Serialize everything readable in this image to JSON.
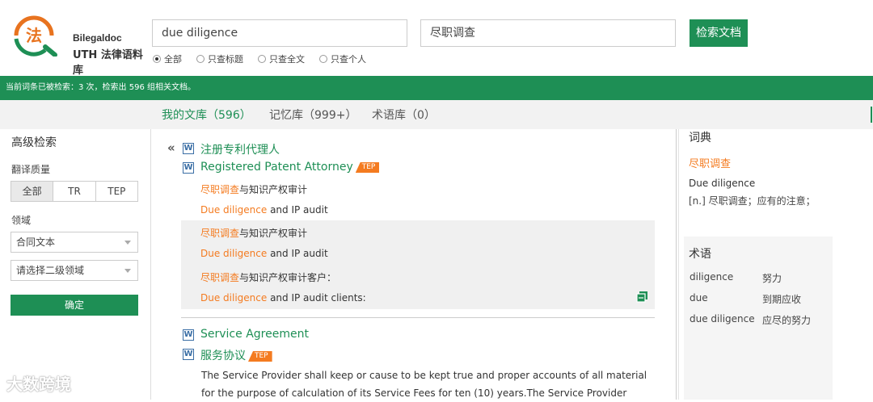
{
  "brand": {
    "name_line1": "Bilegaldoc",
    "name_line2": "UTH 法律语料库"
  },
  "search": {
    "query_en": "due diligence",
    "query_zh": "尽职调查",
    "button": "检索文档"
  },
  "scope_options": [
    {
      "label": "全部",
      "selected": true
    },
    {
      "label": "只查标题",
      "selected": false
    },
    {
      "label": "只查全文",
      "selected": false
    },
    {
      "label": "只查个人",
      "selected": false
    }
  ],
  "status": {
    "text": "当前词条已被检索：3 次，检索出 596 组相关文档。"
  },
  "tabs": [
    {
      "label": "我的文库（596）",
      "active": true
    },
    {
      "label": "记忆库（999+）",
      "active": false
    },
    {
      "label": "术语库（0）",
      "active": false
    }
  ],
  "sidebar": {
    "title": "高级检索",
    "quality_label": "翻译质量",
    "quality_options": [
      "全部",
      "TR",
      "TEP"
    ],
    "domain_label": "领域",
    "domain_value": "合同文本",
    "subdomain_placeholder": "请选择二级领域",
    "confirm": "确定"
  },
  "results": [
    {
      "title_zh": "注册专利代理人",
      "title_en": "Registered Patent Attorney",
      "badge": "TEP",
      "pairs": [
        {
          "zh_hl": "尽职调查",
          "zh_rest": "与知识产权审计",
          "en_hl": "Due diligence",
          "en_rest": " and IP audit"
        },
        {
          "zh_hl": "尽职调查",
          "zh_rest": "与知识产权审计",
          "en_hl": "Due diligence",
          "en_rest": " and IP audit"
        },
        {
          "zh_hl": "尽职调查",
          "zh_rest": "与知识产权审计客户：",
          "en_hl": "Due diligence",
          "en_rest": " and IP audit clients:"
        }
      ]
    },
    {
      "title_en": "Service Agreement",
      "title_zh": "服务协议",
      "badge": "TEP",
      "body_line1": "The Service Provider shall keep or cause to be kept true and proper accounts of all material",
      "body_line2": "for the purpose of calculation of its Service Fees for ten (10) years.The Service Provider"
    }
  ],
  "dictionary": {
    "heading": "词典",
    "term_zh": "尽职调查",
    "term_en": "Due diligence",
    "definition": "[n.]  尽职调查；应有的注意；"
  },
  "terminology": {
    "heading": "术语",
    "rows": [
      {
        "en": "diligence",
        "zh": "努力"
      },
      {
        "en": "due",
        "zh": "到期应收"
      },
      {
        "en": "due diligence",
        "zh": "应尽的努力"
      }
    ]
  },
  "watermark": "大数跨境",
  "colors": {
    "brand_green": "#1e8f55",
    "highlight_orange": "#f47b20",
    "logo_orange": "#e8731f"
  },
  "icons": [
    "logo-scale-magnifier-icon",
    "word-doc-icon",
    "collapse-double-chevron-icon",
    "copy-icon",
    "chevron-down-icon"
  ]
}
